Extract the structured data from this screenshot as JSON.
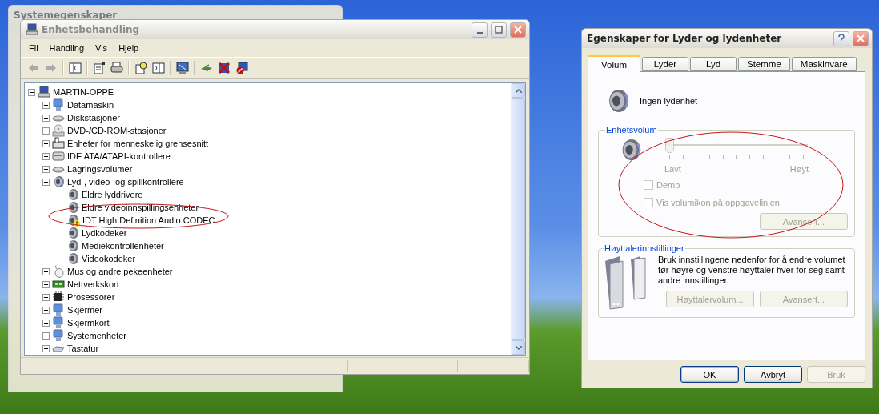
{
  "background_window": {
    "title": "Systemegenskaper"
  },
  "device_manager": {
    "title": "Enhetsbehandling",
    "menu": [
      "Fil",
      "Handling",
      "Vis",
      "Hjelp"
    ],
    "tree": {
      "label": "MARTIN-OPPE",
      "kind": "computer",
      "expanded": true,
      "children": [
        {
          "label": "Datamaskin",
          "kind": "monitor",
          "expanded": false
        },
        {
          "label": "Diskstasjoner",
          "kind": "disk",
          "expanded": false
        },
        {
          "label": "DVD-/CD-ROM-stasjoner",
          "kind": "cd",
          "expanded": false
        },
        {
          "label": "Enheter for menneskelig grensesnitt",
          "kind": "hid",
          "expanded": false
        },
        {
          "label": "IDE ATA/ATAPI-kontrollere",
          "kind": "controller",
          "expanded": false
        },
        {
          "label": "Lagringsvolumer",
          "kind": "disk",
          "expanded": false
        },
        {
          "label": "Lyd-, video- og spillkontrollere",
          "kind": "sound",
          "expanded": true,
          "children": [
            {
              "label": "Eldre lyddrivere",
              "kind": "sound",
              "warning": false
            },
            {
              "label": "Eldre videoinnspillingsenheter",
              "kind": "sound",
              "warning": false
            },
            {
              "label": "IDT High Definition Audio CODEC",
              "kind": "sound",
              "warning": true
            },
            {
              "label": "Lydkodeker",
              "kind": "sound",
              "warning": false
            },
            {
              "label": "Mediekontrollenheter",
              "kind": "sound",
              "warning": false
            },
            {
              "label": "Videokodeker",
              "kind": "sound",
              "warning": false
            }
          ]
        },
        {
          "label": "Mus og andre pekeenheter",
          "kind": "mouse",
          "expanded": false
        },
        {
          "label": "Nettverkskort",
          "kind": "network",
          "expanded": false
        },
        {
          "label": "Prosessorer",
          "kind": "cpu",
          "expanded": false
        },
        {
          "label": "Skjermer",
          "kind": "monitor",
          "expanded": false
        },
        {
          "label": "Skjermkort",
          "kind": "monitor",
          "expanded": false
        },
        {
          "label": "Systemenheter",
          "kind": "monitor",
          "expanded": false
        },
        {
          "label": "Tastatur",
          "kind": "keyboard",
          "expanded": false
        }
      ]
    }
  },
  "sound_dialog": {
    "title": "Egenskaper for Lyder og lydenheter",
    "tabs": [
      {
        "label": "Volum",
        "selected": true
      },
      {
        "label": "Lyder",
        "selected": false
      },
      {
        "label": "Lyd",
        "selected": false
      },
      {
        "label": "Stemme",
        "selected": false
      },
      {
        "label": "Maskinvare",
        "selected": false
      }
    ],
    "device_name": "Ingen lydenhet",
    "device_volume": {
      "title": "Enhetsvolum",
      "level": 0,
      "disabled": true,
      "low_label": "Lavt",
      "high_label": "Høyt",
      "checkboxes": [
        {
          "label": "Demp",
          "checked": false,
          "disabled": true
        },
        {
          "label": "Vis volumikon på oppgavelinjen",
          "checked": false,
          "disabled": true
        }
      ],
      "advanced_button": {
        "label": "Avansert...",
        "disabled": true
      }
    },
    "speaker_settings": {
      "title": "Høyttalerinnstillinger",
      "description": "Bruk innstillingene nedenfor for å endre volumet før høyre og venstre høyttaler hver for seg samt andre innstillinger.",
      "buttons": [
        {
          "label": "Høyttalervolum...",
          "disabled": true
        },
        {
          "label": "Avansert...",
          "disabled": true
        }
      ]
    },
    "buttons": [
      {
        "label": "OK",
        "disabled": false,
        "default": true
      },
      {
        "label": "Avbryt",
        "disabled": false,
        "default": false
      },
      {
        "label": "Bruk",
        "disabled": true,
        "default": false
      }
    ]
  }
}
